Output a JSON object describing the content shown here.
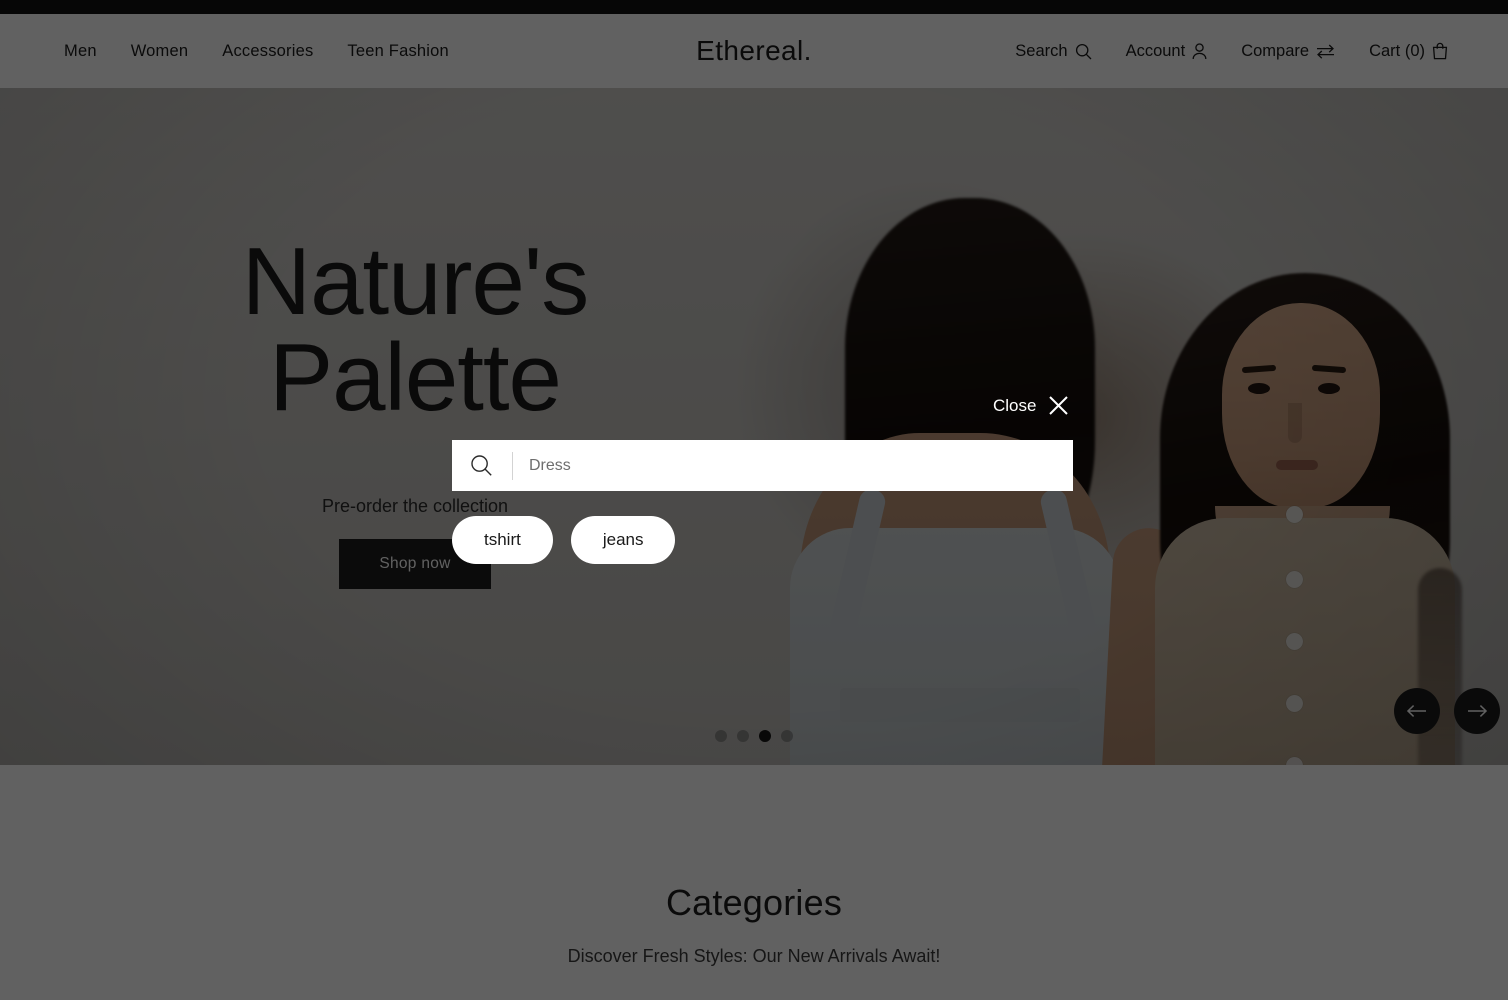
{
  "brand": {
    "name": "Ethereal."
  },
  "topbar": {
    "present": true
  },
  "nav": {
    "items": [
      {
        "label": "Men"
      },
      {
        "label": "Women"
      },
      {
        "label": "Accessories"
      },
      {
        "label": "Teen Fashion"
      }
    ]
  },
  "utilities": {
    "search": {
      "label": "Search",
      "icon": "search-icon"
    },
    "account": {
      "label": "Account",
      "icon": "user-icon"
    },
    "compare": {
      "label": "Compare",
      "icon": "compare-arrows-icon"
    },
    "cart": {
      "label": "Cart (0)",
      "count": 0,
      "icon": "shopping-bag-icon"
    }
  },
  "hero": {
    "title": "Nature's Palette",
    "subtitle": "Pre-order the collection",
    "cta_label": "Shop now",
    "carousel": {
      "total_slides": 4,
      "active_index": 2,
      "prev_label": "Previous slide",
      "next_label": "Next slide"
    }
  },
  "categories": {
    "title": "Categories",
    "subtitle": "Discover Fresh Styles: Our New Arrivals Await!"
  },
  "search_overlay": {
    "open": true,
    "close_label": "Close",
    "close_icon": "close-x-icon",
    "input_placeholder": "Dress",
    "input_value": "",
    "search_icon": "search-icon",
    "suggestions": [
      {
        "label": "tshirt"
      },
      {
        "label": "jeans"
      }
    ]
  },
  "colors": {
    "topbar": "#101010",
    "page_background": "#ffffff",
    "text_primary": "#1c1c1c",
    "cta_background": "#1d1d1d",
    "cta_text": "#ffffff",
    "overlay_dim": "rgba(0,0,0,0.62)",
    "pill_background": "#ffffff",
    "active_dot": "#171717"
  }
}
